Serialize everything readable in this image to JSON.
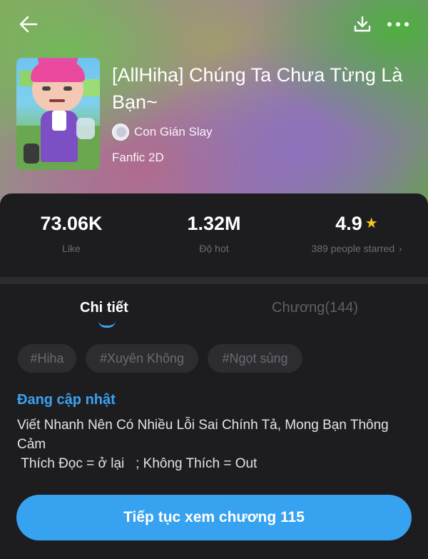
{
  "header": {
    "back_icon": "arrow-left-icon",
    "download_icon": "download-icon",
    "more_icon": "more-horizontal-icon"
  },
  "story": {
    "title": "[AllHiha] Chúng Ta Chưa Từng Là Bạn~",
    "author": "Con Gián Slay",
    "genre": "Fanfic 2D"
  },
  "stats": {
    "likes": {
      "value": "73.06K",
      "label": "Like"
    },
    "hot": {
      "value": "1.32M",
      "label": "Độ hot"
    },
    "rating": {
      "value": "4.9",
      "label": "389 people starred"
    }
  },
  "tabs": [
    {
      "label": "Chi tiết",
      "active": true
    },
    {
      "label": "Chương(144)",
      "active": false
    }
  ],
  "tags": [
    "#Hiha",
    "#Xuyên Không",
    "#Ngọt sủng"
  ],
  "status": "Đang cập nhật",
  "description": "Viết Nhanh Nên Có Nhiều Lỗi Sai Chính Tả, Mong Bạn Thông Cảm\n Thích Đọc = ở lại   ; Không Thích = Out",
  "cta": {
    "label": "Tiếp tục xem chương 115"
  },
  "colors": {
    "accent": "#36a2f0",
    "star": "#f5c518",
    "panel": "#1d1d20"
  }
}
